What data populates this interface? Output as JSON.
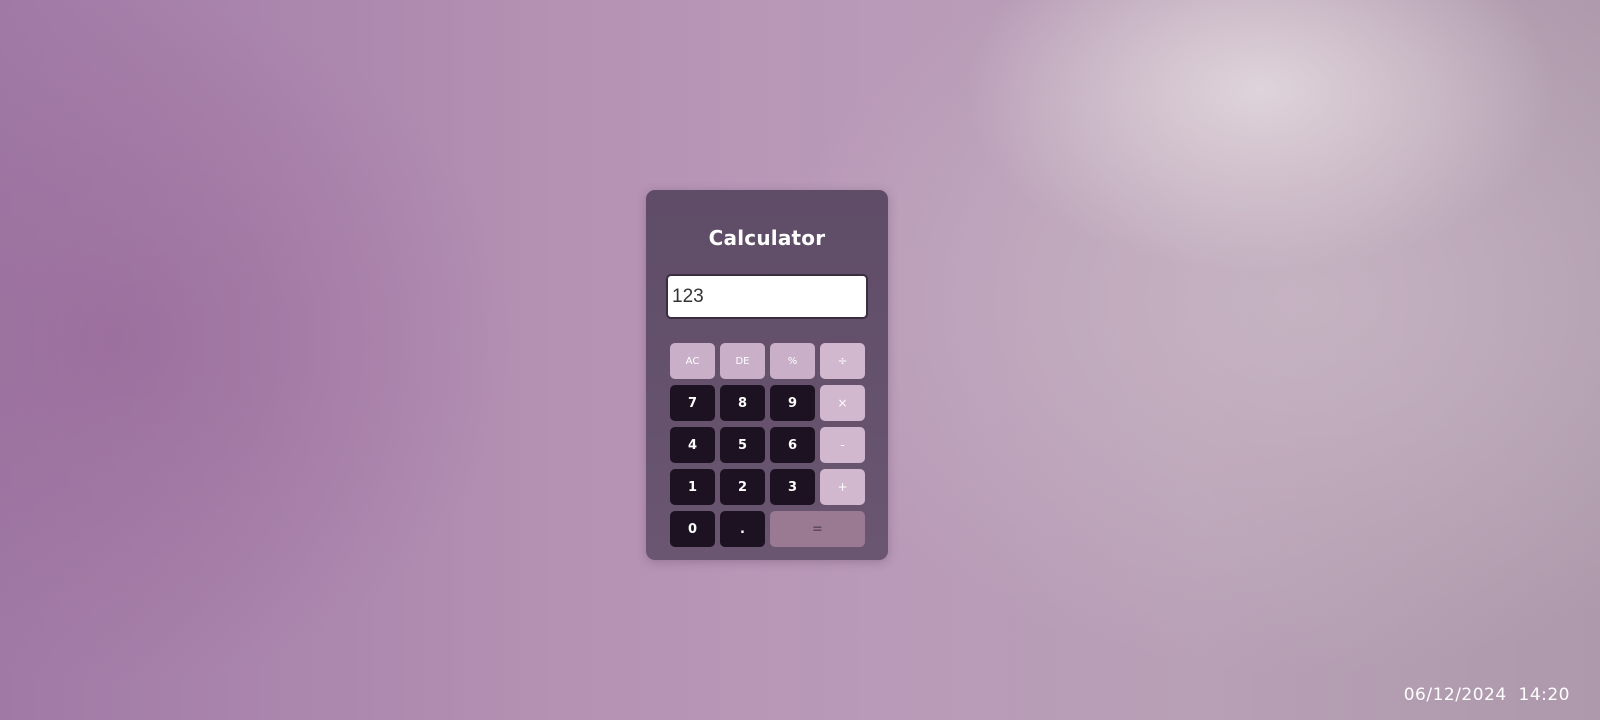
{
  "calculator": {
    "title": "Calculator",
    "display_value": "123",
    "keys": {
      "ac": "AC",
      "de": "DE",
      "percent": "%",
      "divide": "÷",
      "seven": "7",
      "eight": "8",
      "nine": "9",
      "multiply": "×",
      "four": "4",
      "five": "5",
      "six": "6",
      "subtract": "-",
      "one": "1",
      "two": "2",
      "three": "3",
      "add": "+",
      "zero": "0",
      "decimal": ".",
      "equals": "="
    }
  },
  "photo_overlay": {
    "date": "06/12/2024",
    "time": "14:20"
  },
  "colors": {
    "calculator_body": "#5f4c67",
    "number_key": "#1d1222",
    "function_key": "#c9b0c8",
    "operator_key": "#d2b8cf",
    "equals_key": "#9a7a93"
  }
}
